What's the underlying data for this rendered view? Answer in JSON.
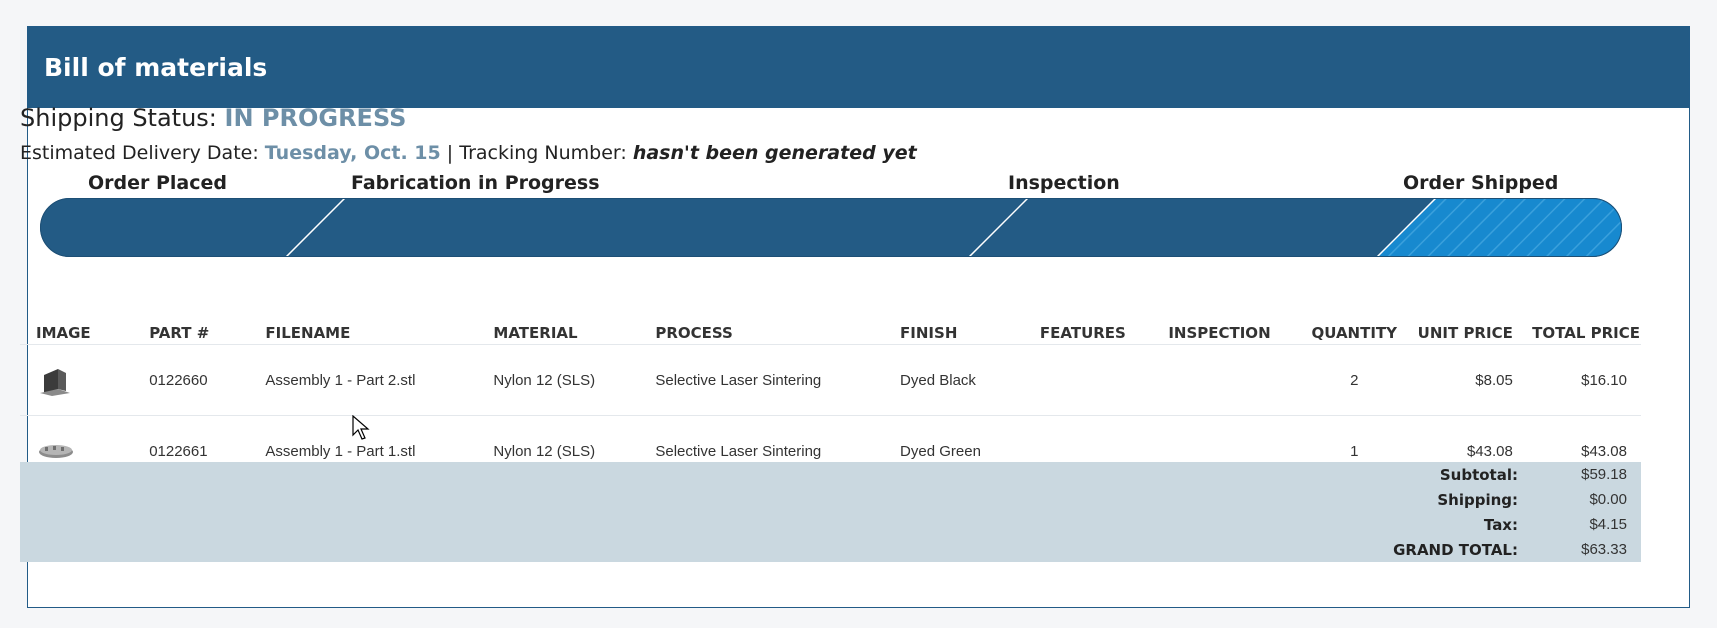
{
  "header": {
    "title": "Bill of materials"
  },
  "shipping": {
    "status_label": "Shipping Status:",
    "status_value": "IN PROGRESS",
    "delivery_label": "Estimated Delivery Date:",
    "delivery_value": "Tuesday, Oct. 15",
    "separator": "|",
    "tracking_label": "Tracking Number:",
    "tracking_value": "hasn't been generated yet"
  },
  "progress": {
    "steps": [
      "Order Placed",
      "Fabrication in Progress",
      "Inspection",
      "Order Shipped"
    ],
    "colors": {
      "bar": "#235b85",
      "active": "#1789cf"
    }
  },
  "table": {
    "columns": [
      "IMAGE",
      "PART #",
      "FILENAME",
      "MATERIAL",
      "PROCESS",
      "FINISH",
      "FEATURES",
      "INSPECTION",
      "QUANTITY",
      "UNIT PRICE",
      "TOTAL PRICE"
    ],
    "rows": [
      {
        "image_icon": "bracket-part-icon",
        "part": "0122660",
        "filename": "Assembly 1 - Part 2.stl",
        "material": "Nylon 12 (SLS)",
        "process": "Selective Laser Sintering",
        "finish": "Dyed Black",
        "features": "",
        "inspection": "",
        "quantity": "2",
        "unit_price": "$8.05",
        "total_price": "$16.10"
      },
      {
        "image_icon": "flat-part-icon",
        "part": "0122661",
        "filename": "Assembly 1 - Part 1.stl",
        "material": "Nylon 12 (SLS)",
        "process": "Selective Laser Sintering",
        "finish": "Dyed Green",
        "features": "",
        "inspection": "",
        "quantity": "1",
        "unit_price": "$43.08",
        "total_price": "$43.08"
      }
    ]
  },
  "summary": {
    "subtotal_label": "Subtotal:",
    "subtotal": "$59.18",
    "shipping_label": "Shipping:",
    "shipping": "$0.00",
    "tax_label": "Tax:",
    "tax": "$4.15",
    "grand_label": "GRAND TOTAL:",
    "grand": "$63.33"
  }
}
